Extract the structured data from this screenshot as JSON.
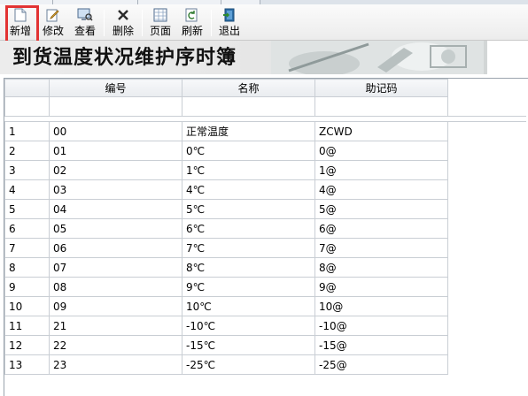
{
  "toolbar": {
    "buttons": [
      {
        "id": "new",
        "label": "新增",
        "icon": "new-document-icon"
      },
      {
        "id": "edit",
        "label": "修改",
        "icon": "edit-pencil-icon"
      },
      {
        "id": "view",
        "label": "查看",
        "icon": "view-monitor-icon"
      },
      {
        "id": "delete",
        "label": "删除",
        "icon": "delete-x-icon"
      },
      {
        "id": "page",
        "label": "页面",
        "icon": "page-grid-icon"
      },
      {
        "id": "refresh",
        "label": "刷新",
        "icon": "refresh-icon"
      },
      {
        "id": "exit",
        "label": "退出",
        "icon": "exit-door-icon"
      }
    ],
    "highlighted": "new"
  },
  "title": "到货温度状况维护序时簿",
  "grid": {
    "columns": [
      "编号",
      "名称",
      "助记码"
    ],
    "rows": [
      {
        "n": "1",
        "code": "00",
        "name": "正常温度",
        "mnemonic": "ZCWD"
      },
      {
        "n": "2",
        "code": "01",
        "name": "0℃",
        "mnemonic": "0@"
      },
      {
        "n": "3",
        "code": "02",
        "name": "1℃",
        "mnemonic": "1@"
      },
      {
        "n": "4",
        "code": "03",
        "name": "4℃",
        "mnemonic": "4@"
      },
      {
        "n": "5",
        "code": "04",
        "name": "5℃",
        "mnemonic": "5@"
      },
      {
        "n": "6",
        "code": "05",
        "name": "6℃",
        "mnemonic": "6@"
      },
      {
        "n": "7",
        "code": "06",
        "name": "7℃",
        "mnemonic": "7@"
      },
      {
        "n": "8",
        "code": "07",
        "name": "8℃",
        "mnemonic": "8@"
      },
      {
        "n": "9",
        "code": "08",
        "name": "9℃",
        "mnemonic": "9@"
      },
      {
        "n": "10",
        "code": "09",
        "name": "10℃",
        "mnemonic": "10@"
      },
      {
        "n": "11",
        "code": "21",
        "name": "-10℃",
        "mnemonic": "-10@"
      },
      {
        "n": "12",
        "code": "22",
        "name": "-15℃",
        "mnemonic": "-15@"
      },
      {
        "n": "13",
        "code": "23",
        "name": "-25℃",
        "mnemonic": "-25@"
      }
    ]
  },
  "colors": {
    "highlight": "#e23333",
    "grid_line": "#c9ced4",
    "header_bg": "#e9ecef"
  }
}
